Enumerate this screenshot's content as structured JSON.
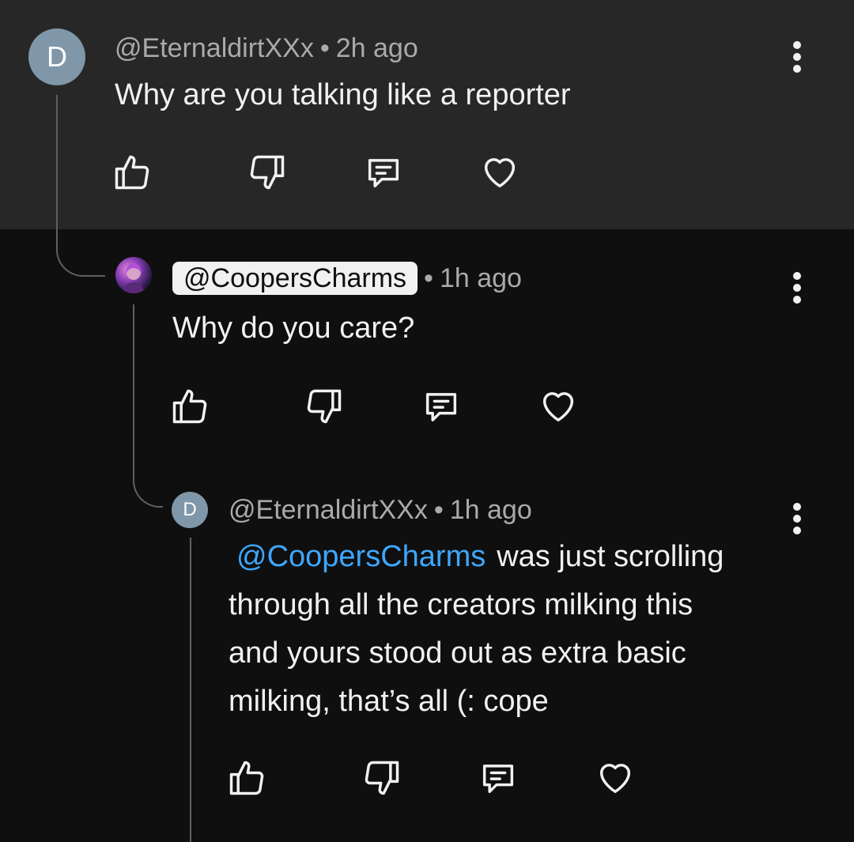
{
  "comments": [
    {
      "avatar_letter": "D",
      "handle": "@EternaldirtXXx",
      "time": "2h ago",
      "text": "Why are you talking like a reporter"
    },
    {
      "handle": "@CoopersCharms",
      "time": "1h ago",
      "text": "Why do you care?"
    },
    {
      "avatar_letter": "D",
      "handle": "@EternaldirtXXx",
      "time": "1h ago",
      "mention": "@CoopersCharms",
      "text_line1": "was just scrolling",
      "text_line2": "through all the creators milking this",
      "text_line3": "and yours stood out as extra basic",
      "text_line4": "milking, that’s all (: cope"
    }
  ],
  "meta_separator": "•",
  "icons": [
    "like-icon",
    "dislike-icon",
    "reply-icon",
    "heart-icon",
    "more-options-icon"
  ],
  "colors": {
    "mention": "#3ea6ff",
    "highlight": "#272727",
    "background": "#0f0f0f"
  }
}
